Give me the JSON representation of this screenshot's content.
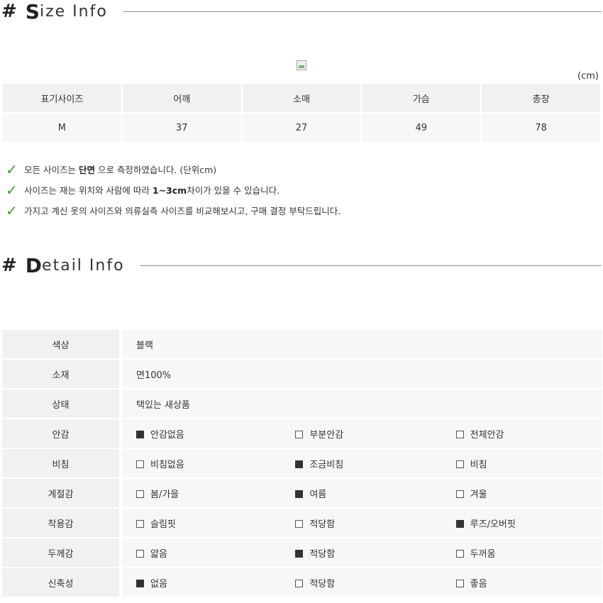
{
  "size_info": {
    "hash": "#",
    "title_big": "S",
    "title_rest": "ize Info",
    "unit": "(cm)",
    "headers": [
      "표기사이즈",
      "어깨",
      "소매",
      "가슴",
      "총장"
    ],
    "row": [
      "M",
      "37",
      "27",
      "49",
      "78"
    ]
  },
  "notes": [
    {
      "check": "✓",
      "pre": "모든 사이즈는 ",
      "bold": "단면",
      "post": " 으로 측정하였습니다. (단위cm)"
    },
    {
      "check": "✓",
      "pre": "사이즈는 재는 위치와 사람에 따라 ",
      "bold": "1~3cm",
      "post": "차이가 있을 수 있습니다."
    },
    {
      "check": "✓",
      "pre": "가지고 계신 옷의 사이즈와 의류실측 사이즈를 비교해보시고, 구매 결정 부탁드립니다.",
      "bold": "",
      "post": ""
    }
  ],
  "detail_info": {
    "hash": "#",
    "title_big": "D",
    "title_rest": "etail Info",
    "simple_rows": [
      {
        "label": "색상",
        "value": "블랙"
      },
      {
        "label": "소재",
        "value": "면100%"
      },
      {
        "label": "상태",
        "value": "택있는 새상품"
      }
    ],
    "option_rows": [
      {
        "label": "안감",
        "options": [
          {
            "text": "안감없음",
            "checked": true
          },
          {
            "text": "부분안감",
            "checked": false
          },
          {
            "text": "전체안감",
            "checked": false
          }
        ]
      },
      {
        "label": "비침",
        "options": [
          {
            "text": "비침없음",
            "checked": false
          },
          {
            "text": "조금비침",
            "checked": true
          },
          {
            "text": "비침",
            "checked": false
          }
        ]
      },
      {
        "label": "계절감",
        "options": [
          {
            "text": "봄/가을",
            "checked": false
          },
          {
            "text": "여름",
            "checked": true
          },
          {
            "text": "겨울",
            "checked": false
          }
        ]
      },
      {
        "label": "착용감",
        "options": [
          {
            "text": "슬림핏",
            "checked": false
          },
          {
            "text": "적당함",
            "checked": false
          },
          {
            "text": "루즈/오버핏",
            "checked": true
          }
        ]
      },
      {
        "label": "두께감",
        "options": [
          {
            "text": "얇음",
            "checked": false
          },
          {
            "text": "적당함",
            "checked": true
          },
          {
            "text": "두꺼움",
            "checked": false
          }
        ]
      },
      {
        "label": "신축성",
        "options": [
          {
            "text": "없음",
            "checked": true
          },
          {
            "text": "적당함",
            "checked": false
          },
          {
            "text": "좋음",
            "checked": false
          }
        ]
      }
    ]
  },
  "colors": {
    "check_green": "#39a02a",
    "checked_box": "#333333",
    "label_bg": "#f1f1f1",
    "value_bg": "#f7f7f7"
  }
}
